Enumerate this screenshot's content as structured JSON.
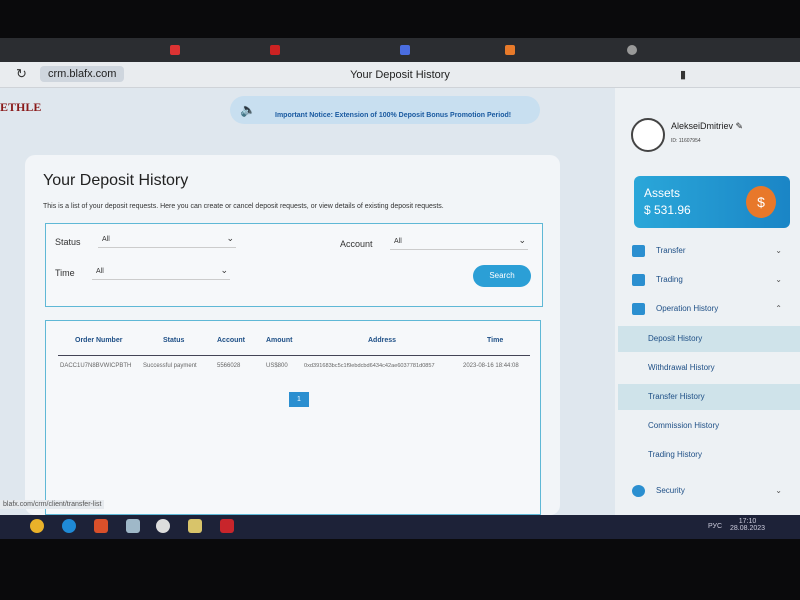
{
  "browser": {
    "url": "crm.blafx.com",
    "page_title": "Your Deposit History",
    "status_url": "blafx.com/crm/client/transfer-list"
  },
  "logo": "ETHLE",
  "notice": "Important Notice: Extension of 100% Deposit Bonus Promotion Period!",
  "main": {
    "title": "Your Deposit History",
    "description": "This is a list of your deposit requests. Here you can create or cancel deposit requests, or view details of existing deposit requests.",
    "filters": {
      "status_label": "Status",
      "status_value": "All",
      "account_label": "Account",
      "account_value": "All",
      "time_label": "Time",
      "time_value": "All",
      "search_label": "Search"
    },
    "table": {
      "headers": [
        "Order Number",
        "Status",
        "Account",
        "Amount",
        "Address",
        "Time"
      ],
      "rows": [
        [
          "DACC1U7N8BVWICPBTH",
          "Successful payment",
          "5566028",
          "US$800",
          "0xd391683bc5c1f9ebdcbd6434c42ae6037781d0857",
          "2023-08-16 18:44:08"
        ]
      ]
    },
    "pagination": {
      "current": "1"
    }
  },
  "sidebar": {
    "username": "AlekseiDmitriev",
    "uid": "ID: 11607954",
    "assets_label": "Assets",
    "assets_value": "$ 531.96",
    "items": [
      {
        "label": "Transfer"
      },
      {
        "label": "Trading"
      },
      {
        "label": "Operation History"
      },
      {
        "label": "Deposit History"
      },
      {
        "label": "Withdrawal History"
      },
      {
        "label": "Transfer History"
      },
      {
        "label": "Commission History"
      },
      {
        "label": "Trading History"
      },
      {
        "label": "Security"
      }
    ]
  },
  "taskbar": {
    "lang": "РУС",
    "time": "17:10",
    "date": "28.08.2023"
  }
}
